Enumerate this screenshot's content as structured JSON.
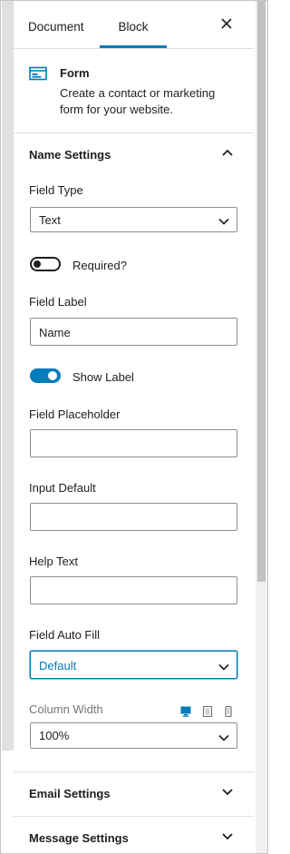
{
  "tabs": {
    "document": "Document",
    "block": "Block"
  },
  "block_card": {
    "name": "Form",
    "description": "Create a contact or marketing form for your website."
  },
  "sections": {
    "name_settings": "Name Settings",
    "email_settings": "Email Settings",
    "message_settings": "Message Settings"
  },
  "fields": {
    "field_type": {
      "label": "Field Type",
      "value": "Text"
    },
    "required": {
      "label": "Required?",
      "checked": false
    },
    "field_label": {
      "label": "Field Label",
      "value": "Name"
    },
    "show_label": {
      "label": "Show Label",
      "checked": true
    },
    "field_placeholder": {
      "label": "Field Placeholder",
      "value": ""
    },
    "input_default": {
      "label": "Input Default",
      "value": ""
    },
    "help_text": {
      "label": "Help Text",
      "value": ""
    },
    "field_auto_fill": {
      "label": "Field Auto Fill",
      "value": "Default"
    },
    "column_width": {
      "label": "Column Width",
      "value": "100%"
    }
  },
  "colors": {
    "accent": "#007cba",
    "text": "#1e1e1e",
    "border": "#8c8f94",
    "muted_label": "#757575"
  },
  "icons": [
    "close-icon",
    "form-icon",
    "chevron-up-icon",
    "chevron-down-icon",
    "desktop-icon",
    "tablet-icon",
    "mobile-icon"
  ]
}
